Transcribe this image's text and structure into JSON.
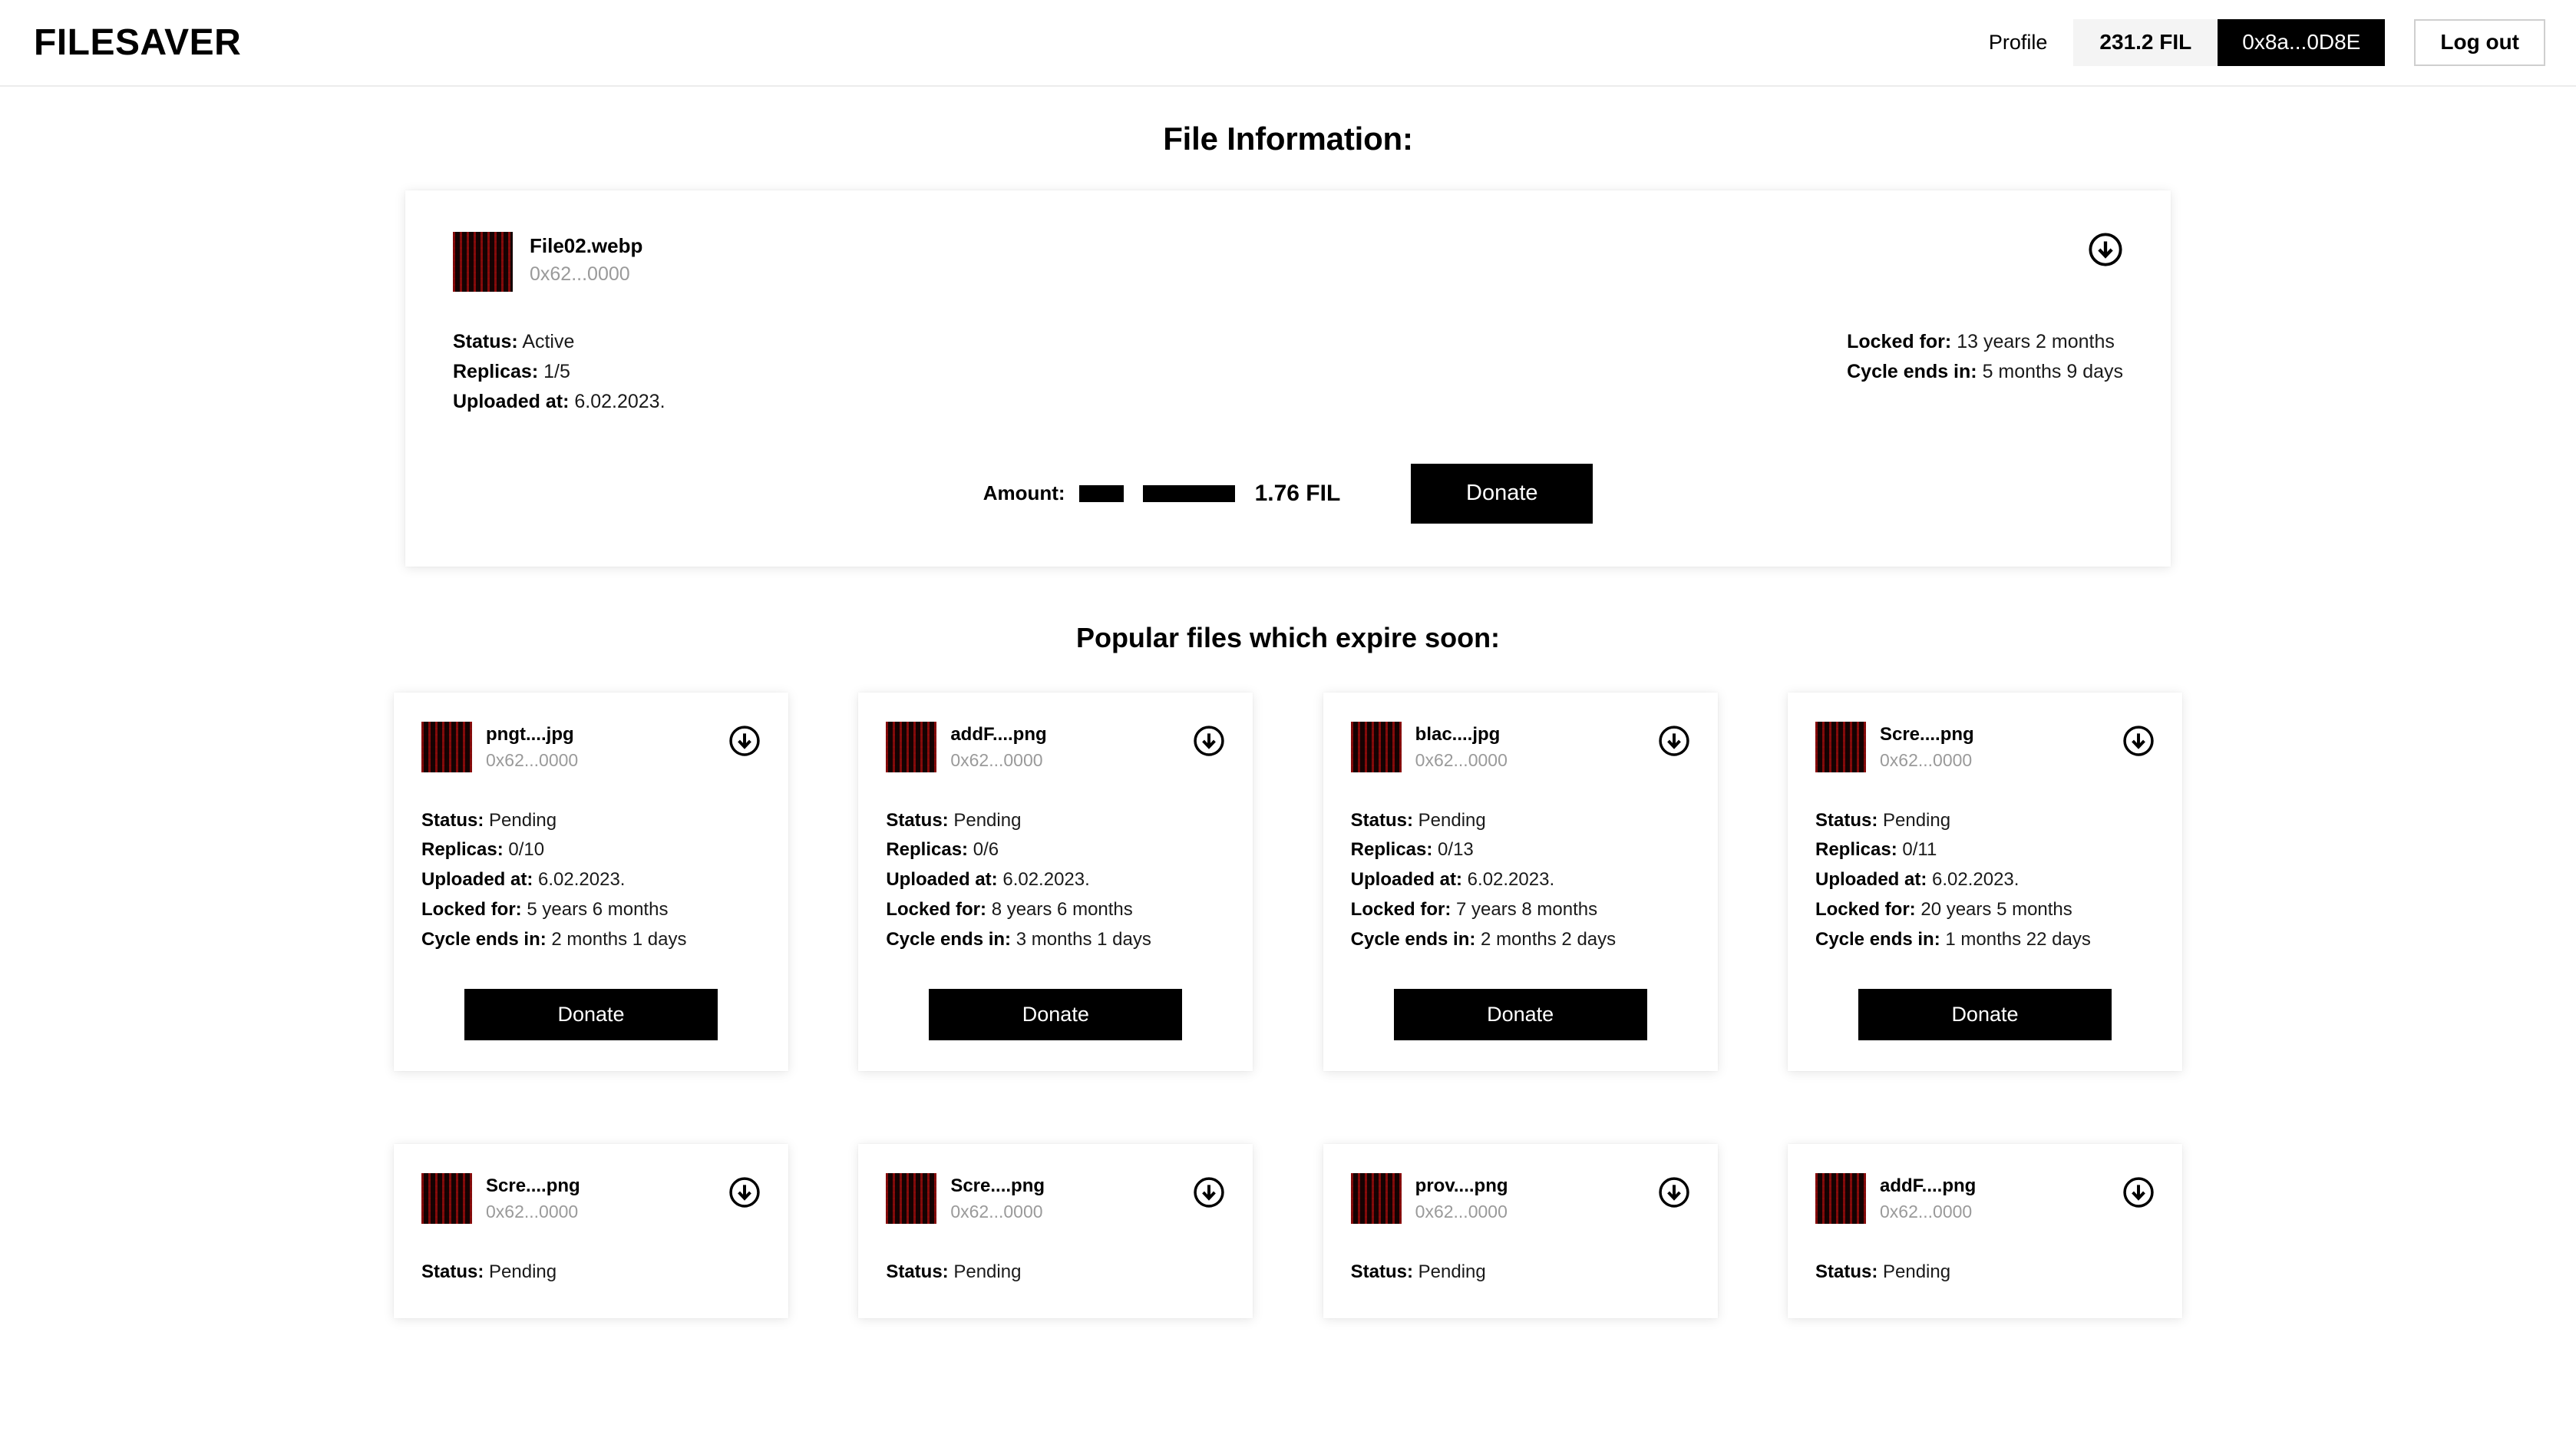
{
  "header": {
    "brand": "FILESAVER",
    "profile_label": "Profile",
    "balance": "231.2 FIL",
    "address": "0x8a...0D8E",
    "logout_label": "Log out"
  },
  "page_title": "File Information:",
  "main_file": {
    "name": "File02.webp",
    "address": "0x62...0000",
    "status_label": "Status:",
    "status_value": "Active",
    "replicas_label": "Replicas:",
    "replicas_value": "1/5",
    "uploaded_label": "Uploaded at:",
    "uploaded_value": "6.02.2023.",
    "locked_label": "Locked for:",
    "locked_value": "13 years 2 months",
    "cycle_label": "Cycle ends in:",
    "cycle_value": "5 months 9 days",
    "amount_label": "Amount:",
    "amount_value": "1.76 FIL",
    "slider_percent": 29,
    "donate_label": "Donate",
    "download_icon": "download-circle-icon"
  },
  "section_title": "Popular files which expire soon:",
  "labels": {
    "status": "Status:",
    "replicas": "Replicas:",
    "uploaded": "Uploaded at:",
    "locked": "Locked for:",
    "cycle": "Cycle ends in:",
    "donate": "Donate"
  },
  "popular_files": [
    {
      "name": "pngt....jpg",
      "address": "0x62...0000",
      "status": "Pending",
      "replicas": "0/10",
      "uploaded": "6.02.2023.",
      "locked": "5 years 6 months",
      "cycle": "2 months 1 days"
    },
    {
      "name": "addF....png",
      "address": "0x62...0000",
      "status": "Pending",
      "replicas": "0/6",
      "uploaded": "6.02.2023.",
      "locked": "8 years 6 months",
      "cycle": "3 months 1 days"
    },
    {
      "name": "blac....jpg",
      "address": "0x62...0000",
      "status": "Pending",
      "replicas": "0/13",
      "uploaded": "6.02.2023.",
      "locked": "7 years 8 months",
      "cycle": "2 months 2 days"
    },
    {
      "name": "Scre....png",
      "address": "0x62...0000",
      "status": "Pending",
      "replicas": "0/11",
      "uploaded": "6.02.2023.",
      "locked": "20 years 5 months",
      "cycle": "1 months 22 days"
    },
    {
      "name": "Scre....png",
      "address": "0x62...0000",
      "status": "Pending",
      "replicas": "",
      "uploaded": "",
      "locked": "",
      "cycle": ""
    },
    {
      "name": "Scre....png",
      "address": "0x62...0000",
      "status": "Pending",
      "replicas": "",
      "uploaded": "",
      "locked": "",
      "cycle": ""
    },
    {
      "name": "prov....png",
      "address": "0x62...0000",
      "status": "Pending",
      "replicas": "",
      "uploaded": "",
      "locked": "",
      "cycle": ""
    },
    {
      "name": "addF....png",
      "address": "0x62...0000",
      "status": "Pending",
      "replicas": "",
      "uploaded": "",
      "locked": "",
      "cycle": ""
    }
  ],
  "colors": {
    "accent": "#000000",
    "chip_bg": "#f4f4f4",
    "muted_text": "#9a9a9a",
    "border": "#ececec"
  }
}
